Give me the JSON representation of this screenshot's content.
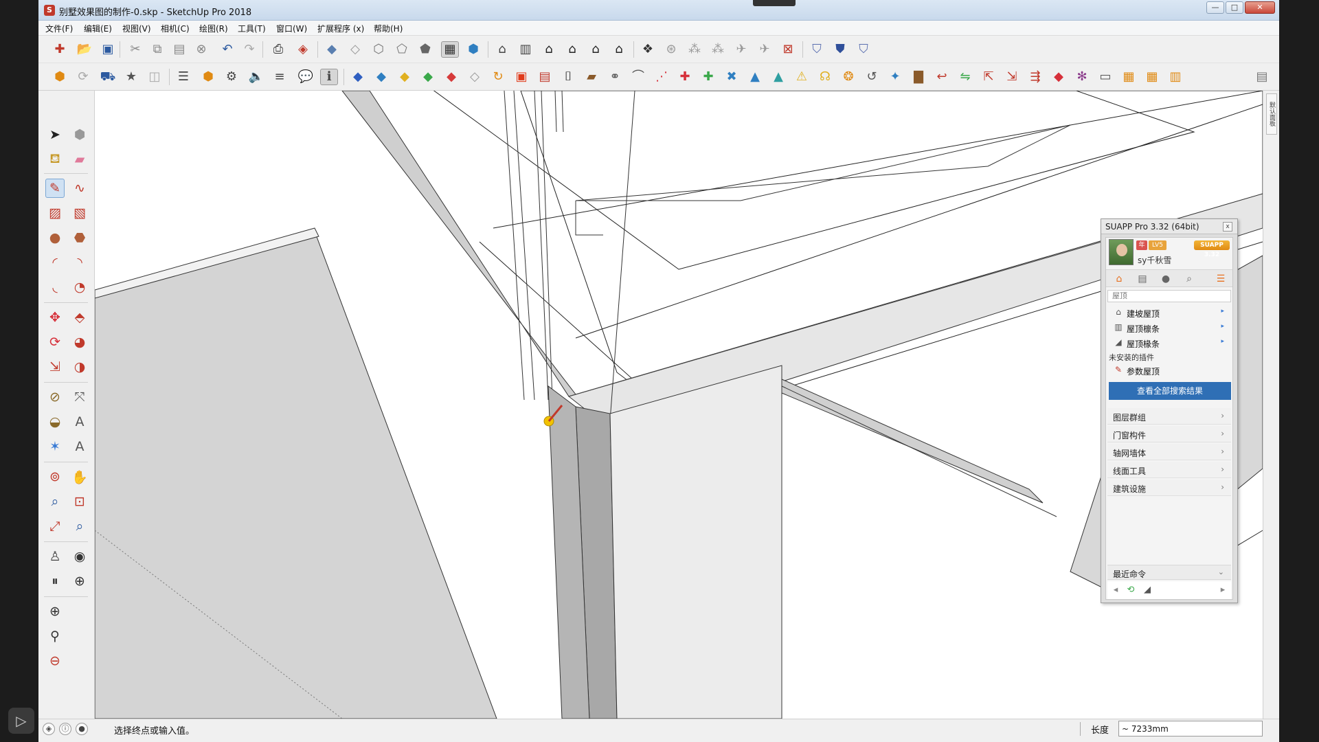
{
  "window": {
    "title": "别墅效果图的制作-0.skp - SketchUp Pro 2018",
    "minimize": "—",
    "maximize": "□",
    "close": "✕"
  },
  "menu": [
    {
      "label": "文件(F)"
    },
    {
      "label": "编辑(E)"
    },
    {
      "label": "视图(V)"
    },
    {
      "label": "相机(C)"
    },
    {
      "label": "绘图(R)"
    },
    {
      "label": "工具(T)"
    },
    {
      "label": "窗口(W)"
    },
    {
      "label": "扩展程序 (x)"
    },
    {
      "label": "帮助(H)"
    }
  ],
  "right_strip": {
    "tab": "默认面板"
  },
  "status": {
    "prompt": "选择终点或输入值。",
    "measure_label": "长度",
    "measure_value": "~ 7233mm"
  },
  "suapp": {
    "title": "SUAPP Pro 3.32 (64bit)",
    "close": "x",
    "username": "sy千秋雪",
    "badge_vip": "年",
    "badge_level": "LV5",
    "version_badge": "SUAPP 3.32",
    "search_value": "屋顶",
    "results": [
      {
        "label": "建坡屋顶",
        "icon": "roof-icon"
      },
      {
        "label": "屋顶檩条",
        "icon": "purlin-icon"
      },
      {
        "label": "屋顶椽条",
        "icon": "rafter-icon"
      }
    ],
    "uninstalled_label": "未安装的插件",
    "uninstalled_item": "参数屋顶",
    "view_all": "查看全部搜索结果",
    "categories": [
      {
        "label": "图层群组"
      },
      {
        "label": "门窗构件"
      },
      {
        "label": "轴网墙体"
      },
      {
        "label": "线面工具"
      },
      {
        "label": "建筑设施"
      }
    ],
    "recent": "最近命令"
  },
  "colors": {
    "accent": "#2f6fb5",
    "suapp_orange": "#e8a33b",
    "face_gray": "#d4d4d4",
    "face_dark": "#a8a8a8"
  }
}
